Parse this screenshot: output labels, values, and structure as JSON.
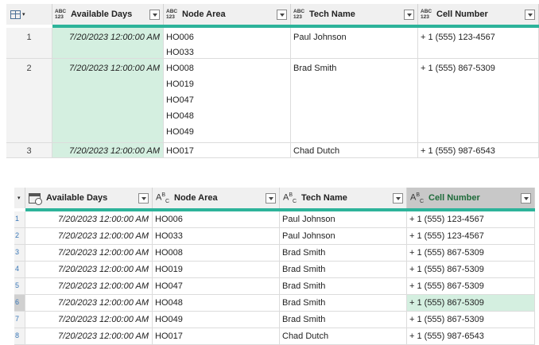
{
  "top_grid": {
    "columns": [
      {
        "type": "ABC\n123",
        "label": "Available Days"
      },
      {
        "type": "ABC\n123",
        "label": "Node Area"
      },
      {
        "type": "ABC\n123",
        "label": "Tech Name"
      },
      {
        "type": "ABC\n123",
        "label": "Cell Number"
      }
    ],
    "rows": [
      {
        "num": "1",
        "date": "7/20/2023 12:00:00 AM",
        "nodes": [
          "HO006",
          "HO033"
        ],
        "tech": "Paul Johnson",
        "cell": "+ 1 (555) 123-4567"
      },
      {
        "num": "2",
        "date": "7/20/2023 12:00:00 AM",
        "nodes": [
          "HO008",
          "HO019",
          "HO047",
          "HO048",
          "HO049"
        ],
        "tech": "Brad Smith",
        "cell": "+ 1 (555) 867-5309"
      },
      {
        "num": "3",
        "date": "7/20/2023 12:00:00 AM",
        "nodes": [
          "HO017"
        ],
        "tech": "Chad Dutch",
        "cell": "+ 1 (555) 987-6543"
      }
    ]
  },
  "bottom_grid": {
    "columns": [
      {
        "type": "calendar-clock-icon",
        "label": "Available Days"
      },
      {
        "type": "A B C",
        "label": "Node Area"
      },
      {
        "type": "A B C",
        "label": "Tech Name"
      },
      {
        "type": "A B C",
        "label": "Cell Number"
      }
    ],
    "rows": [
      {
        "num": "1",
        "date": "7/20/2023 12:00:00 AM",
        "node": "HO006",
        "tech": "Paul Johnson",
        "cell": "+ 1 (555) 123-4567"
      },
      {
        "num": "2",
        "date": "7/20/2023 12:00:00 AM",
        "node": "HO033",
        "tech": "Paul Johnson",
        "cell": "+ 1 (555) 123-4567"
      },
      {
        "num": "3",
        "date": "7/20/2023 12:00:00 AM",
        "node": "HO008",
        "tech": "Brad Smith",
        "cell": "+ 1 (555) 867-5309"
      },
      {
        "num": "4",
        "date": "7/20/2023 12:00:00 AM",
        "node": "HO019",
        "tech": "Brad Smith",
        "cell": "+ 1 (555) 867-5309"
      },
      {
        "num": "5",
        "date": "7/20/2023 12:00:00 AM",
        "node": "HO047",
        "tech": "Brad Smith",
        "cell": "+ 1 (555) 867-5309"
      },
      {
        "num": "6",
        "date": "7/20/2023 12:00:00 AM",
        "node": "HO048",
        "tech": "Brad Smith",
        "cell": "+ 1 (555) 867-5309"
      },
      {
        "num": "7",
        "date": "7/20/2023 12:00:00 AM",
        "node": "HO049",
        "tech": "Brad Smith",
        "cell": "+ 1 (555) 867-5309"
      },
      {
        "num": "8",
        "date": "7/20/2023 12:00:00 AM",
        "node": "HO017",
        "tech": "Chad Dutch",
        "cell": "+ 1 (555) 987-6543"
      }
    ]
  },
  "colors": {
    "accent": "#2db39a",
    "selected_cell": "#d4efe0",
    "selected_header": "#c8c8c8"
  }
}
